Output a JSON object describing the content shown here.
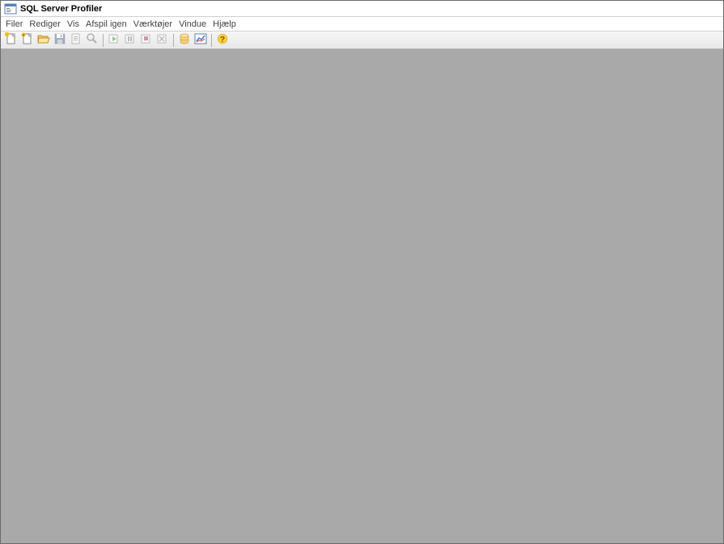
{
  "titlebar": {
    "title": "SQL Server Profiler"
  },
  "menubar": {
    "items": [
      {
        "label": "Filer"
      },
      {
        "label": "Rediger"
      },
      {
        "label": "Vis"
      },
      {
        "label": "Afspil igen"
      },
      {
        "label": "Værktøjer"
      },
      {
        "label": "Vindue"
      },
      {
        "label": "Hjælp"
      }
    ]
  },
  "toolbar": {
    "icons": {
      "new_trace": "new-trace-icon",
      "new_template": "new-template-icon",
      "open_file": "open-file-icon",
      "save": "save-icon",
      "properties": "properties-icon",
      "find": "find-icon",
      "run": "run-icon",
      "pause": "pause-icon",
      "stop": "stop-icon",
      "clear": "clear-icon",
      "database": "database-icon",
      "chart": "chart-icon",
      "help": "help-icon"
    }
  }
}
